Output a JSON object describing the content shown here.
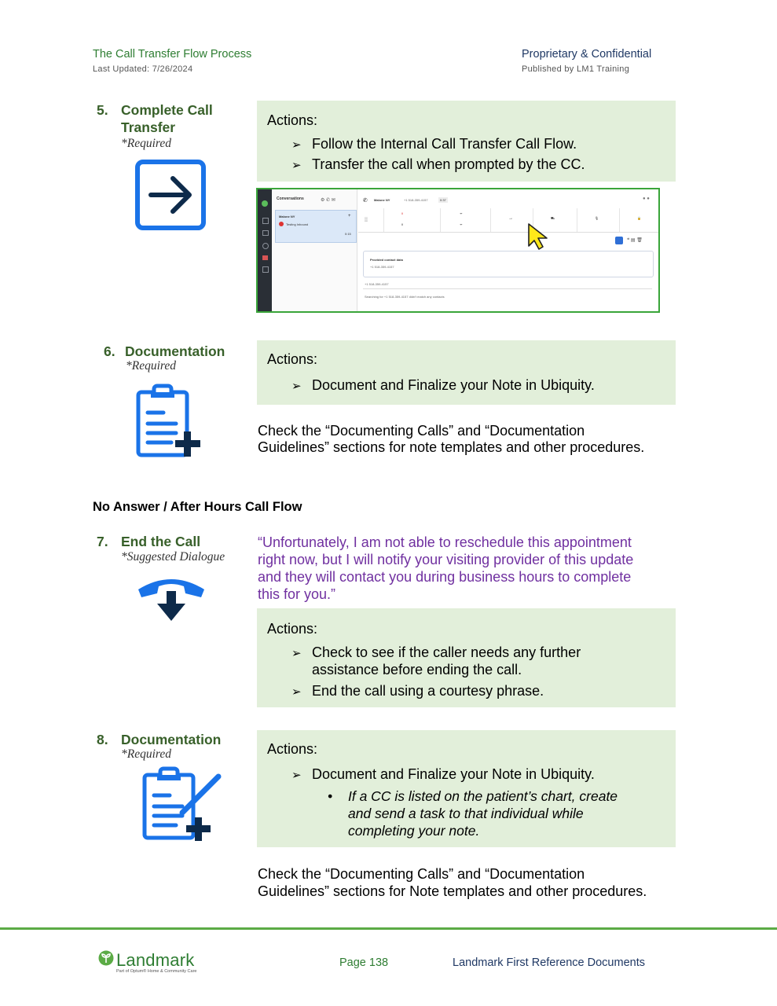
{
  "header": {
    "title": "The Call Transfer Flow Process",
    "updated": "Last Updated: 7/26/2024",
    "confidential": "Proprietary & Confidential",
    "publisher": "Published by LM1 Training"
  },
  "step5": {
    "number": "5.",
    "title_line1": "Complete Call",
    "title_line2": "Transfer",
    "required": "*Required",
    "icon": "arrow-right-square-icon",
    "actions_label": "Actions:",
    "bullets": [
      "Follow the Internal Call Transfer Call Flow.",
      "Transfer the call when prompted by the CC."
    ],
    "screenshot": {
      "panel_title": "Conversations",
      "contact": "Malone NY",
      "call_status": "Testing Inbound",
      "duration": "0:15",
      "number": "+1 518-359-4157",
      "timer": "0:37",
      "provided_label": "Provided contact data",
      "provided_number": "+1 518-359-4157",
      "search_value": "+1 518-359-4157",
      "search_result": "Searching for +1 518-359-4157 didn't match any contacts"
    }
  },
  "step6": {
    "number": "6.",
    "title": "Documentation",
    "required": "*Required",
    "icon": "clipboard-plus-icon",
    "actions_label": "Actions:",
    "bullets": [
      "Document and Finalize your Note in Ubiquity."
    ],
    "note_line1": "Check the “Documenting Calls” and “Documentation",
    "note_line2": "Guidelines” sections for note templates and other procedures."
  },
  "section_heading": "No Answer / After Hours Call Flow",
  "step7": {
    "number": "7.",
    "title": "End the Call",
    "required": "*Suggested Dialogue",
    "icon": "hang-up-phone-icon",
    "dialogue": [
      "“Unfortunately, I am not able to reschedule this appointment",
      "right now, but I will notify your visiting provider of this update",
      "and they will contact you during business hours to complete",
      "this for you.”"
    ],
    "actions_label": "Actions:",
    "bullets": [
      [
        "Check to see if the caller needs any further",
        "assistance before ending the call."
      ],
      [
        "End the call using a courtesy phrase."
      ]
    ]
  },
  "step8": {
    "number": "8.",
    "title": "Documentation",
    "required": "*Required",
    "icon": "clipboard-pen-plus-icon",
    "actions_label": "Actions:",
    "bullets": [
      "Document and Finalize your Note in Ubiquity."
    ],
    "sub_bullets": [
      "If a CC is listed on the patient’s chart, create",
      "and send a task to that individual while",
      "completing your note."
    ],
    "note_line1": "Check the “Documenting Calls” and “Documentation",
    "note_line2": "Guidelines” sections for Note templates and other procedures."
  },
  "footer": {
    "brand": "Landmark",
    "brand_sub": "Part of Optum® Home & Community Care",
    "page": "Page 138",
    "reference": "Landmark First Reference Documents"
  },
  "colors": {
    "accent_green": "#2e7d32",
    "action_bg": "#e2efda",
    "dialogue_purple": "#7030a0",
    "icon_blue": "#1a73e8",
    "footer_rule": "#5bab45"
  }
}
